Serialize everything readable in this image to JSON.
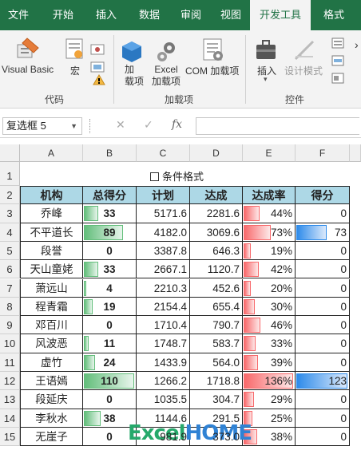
{
  "tabs": [
    "文件",
    "开始",
    "插入",
    "数据",
    "审阅",
    "视图",
    "开发工具",
    "格式"
  ],
  "ribbon": {
    "vb": "Visual Basic",
    "macro": "宏",
    "addin": "加\n载项",
    "excel_addin": "Excel\n加载项",
    "com_addin": "COM 加载项",
    "insert": "插入",
    "design_mode": "设计模式",
    "groups": [
      "代码",
      "加载项",
      "控件"
    ]
  },
  "namebox": "复选框 5",
  "formula_icons": [
    "cancel-icon",
    "confirm-icon",
    "function-icon"
  ],
  "formula_fx": "fx",
  "columns": [
    "A",
    "B",
    "C",
    "D",
    "E",
    "F"
  ],
  "rows": [
    "1",
    "2",
    "3",
    "4",
    "5",
    "6",
    "7",
    "8",
    "9",
    "10",
    "11",
    "12",
    "13",
    "14",
    "15"
  ],
  "checkbox_label": "条件格式",
  "headers": [
    "机构",
    "总得分",
    "计划",
    "达成",
    "达成率",
    "得分"
  ],
  "table": [
    {
      "org": "乔峰",
      "score": 33,
      "plan": "5171.6",
      "done": "2281.6",
      "rate": "44%",
      "pts": "0"
    },
    {
      "org": "不平道长",
      "score": 89,
      "plan": "4182.0",
      "done": "3069.6",
      "rate": "73%",
      "pts": "73"
    },
    {
      "org": "段誉",
      "score": 0,
      "plan": "3387.8",
      "done": "646.3",
      "rate": "19%",
      "pts": "0"
    },
    {
      "org": "天山童姥",
      "score": 33,
      "plan": "2667.1",
      "done": "1120.7",
      "rate": "42%",
      "pts": "0"
    },
    {
      "org": "萧远山",
      "score": 4,
      "plan": "2210.3",
      "done": "452.6",
      "rate": "20%",
      "pts": "0"
    },
    {
      "org": "程青霜",
      "score": 19,
      "plan": "2154.4",
      "done": "655.4",
      "rate": "30%",
      "pts": "0"
    },
    {
      "org": "邓百川",
      "score": 0,
      "plan": "1710.4",
      "done": "790.7",
      "rate": "46%",
      "pts": "0"
    },
    {
      "org": "风波恶",
      "score": 11,
      "plan": "1748.7",
      "done": "583.7",
      "rate": "33%",
      "pts": "0"
    },
    {
      "org": "虚竹",
      "score": 24,
      "plan": "1433.9",
      "done": "564.0",
      "rate": "39%",
      "pts": "0"
    },
    {
      "org": "王语嫣",
      "score": 110,
      "plan": "1266.2",
      "done": "1718.8",
      "rate": "136%",
      "pts": "123"
    },
    {
      "org": "段延庆",
      "score": 0,
      "plan": "1035.5",
      "done": "304.7",
      "rate": "29%",
      "pts": "0"
    },
    {
      "org": "李秋水",
      "score": 38,
      "plan": "1144.6",
      "done": "291.5",
      "rate": "25%",
      "pts": "0"
    },
    {
      "org": "无崖子",
      "score": 0,
      "plan": "981.9",
      "done": "373.0",
      "rate": "38%",
      "pts": "0"
    }
  ],
  "bars": {
    "score": [
      0.28,
      0.78,
      0,
      0.28,
      0.05,
      0.18,
      0,
      0.1,
      0.22,
      1.0,
      0,
      0.33,
      0
    ],
    "rate": [
      0.33,
      0.55,
      0.14,
      0.31,
      0.15,
      0.22,
      0.34,
      0.24,
      0.29,
      1.0,
      0.21,
      0.18,
      0.28
    ],
    "pts": [
      0,
      0.59,
      0,
      0,
      0,
      0,
      0,
      0,
      0,
      1.0,
      0,
      0,
      0
    ]
  },
  "watermark": {
    "a": "Excel",
    "b": "HOME"
  },
  "colors": {
    "green": "#217346",
    "header_fill": "#add8e6",
    "score_bar": "#63be7b",
    "rate_bar": "#f8696b",
    "pts_bar": "#2e8bea"
  }
}
